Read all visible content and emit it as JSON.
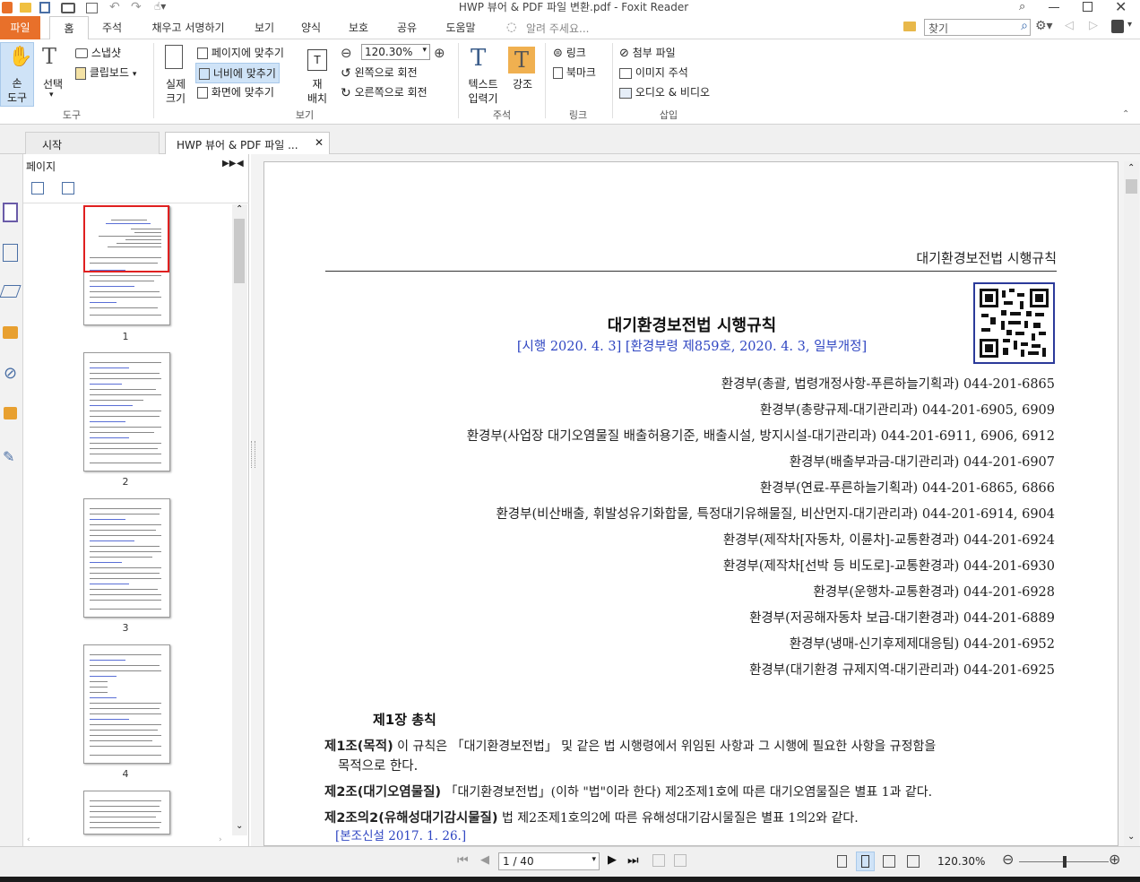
{
  "window": {
    "title": "HWP 뷰어 & PDF 파일 변환.pdf - Foxit Reader",
    "search_placeholder": "찾기"
  },
  "menu": {
    "items": [
      "파일",
      "홈",
      "주석",
      "채우고 서명하기",
      "보기",
      "양식",
      "보호",
      "공유",
      "도움말"
    ],
    "tell_me": "알려 주세요..."
  },
  "ribbon": {
    "tools": {
      "hand": "손\n도구",
      "hand1": "손",
      "hand2": "도구",
      "select": "선택",
      "snapshot": "스냅샷",
      "clipboard": "클립보드",
      "label": "도구"
    },
    "view": {
      "actual1": "실제",
      "actual2": "크기",
      "fit_page": "페이지에 맞추기",
      "fit_width": "너비에 맞추기",
      "fit_visible": "화면에 맞추기",
      "reflow1": "재",
      "reflow2": "배치",
      "zoom": "120.30%",
      "rotate_left": "왼쪽으로 회전",
      "rotate_right": "오른쪽으로 회전",
      "label": "보기"
    },
    "comment": {
      "typewriter1": "텍스트",
      "typewriter2": "입력기",
      "highlight": "강조",
      "label": "주석"
    },
    "links": {
      "link": "링크",
      "bookmark": "북마크",
      "label": "링크"
    },
    "insert": {
      "attach": "첨부 파일",
      "image": "이미지 주석",
      "media": "오디오 & 비디오",
      "label": "삽입"
    }
  },
  "tabs": {
    "start": "시작",
    "doc": "HWP 뷰어 & PDF 파일 ..."
  },
  "panel": {
    "title": "페이지",
    "pages": [
      "1",
      "2",
      "3",
      "4"
    ]
  },
  "document": {
    "header": "대기환경보전법 시행규칙",
    "title": "대기환경보전법 시행규칙",
    "subtitle": "[시행 2020. 4. 3] [환경부령 제859호, 2020. 4. 3, 일부개정]",
    "contacts": [
      "환경부(총괄, 법령개정사항-푸른하늘기획과) 044-201-6865",
      "환경부(총량규제-대기관리과) 044-201-6905, 6909",
      "환경부(사업장 대기오염물질 배출허용기준, 배출시설, 방지시설-대기관리과) 044-201-6911, 6906, 6912",
      "환경부(배출부과금-대기관리과) 044-201-6907",
      "환경부(연료-푸른하늘기획과) 044-201-6865, 6866",
      "환경부(비산배출, 휘발성유기화합물, 특정대기유해물질, 비산먼지-대기관리과) 044-201-6914, 6904",
      "환경부(제작차[자동차, 이륜차]-교통환경과) 044-201-6924",
      "환경부(제작차[선박 등 비도로]-교통환경과) 044-201-6930",
      "환경부(운행차-교통환경과) 044-201-6928",
      "환경부(저공해자동차 보급-대기환경과) 044-201-6889",
      "환경부(냉매-신기후제제대응팀) 044-201-6952",
      "환경부(대기환경 규제지역-대기관리과) 044-201-6925"
    ],
    "chapter": "제1장 총칙",
    "art1_head": "제1조(목적)",
    "art1_body": " 이 규칙은 「대기환경보전법」 및 같은 법 시행령에서 위임된 사항과 그 시행에 필요한 사항을 규정함을",
    "art1_cont": "목적으로 한다.",
    "art2_head": "제2조(대기오염물질)",
    "art2_body": " 「대기환경보전법」(이하 \"법\"이라 한다) 제2조제1호에 따른 대기오염물질은 별표 1과 같다.",
    "art3_head": "제2조의2(유해성대기감시물질)",
    "art3_body": " 법 제2조제1호의2에 따른 유해성대기감시물질은 별표 1의2와 같다.",
    "art3_note": "[본조신설 2017. 1. 26.]"
  },
  "status": {
    "page": "1 / 40",
    "zoom": "120.30%"
  }
}
